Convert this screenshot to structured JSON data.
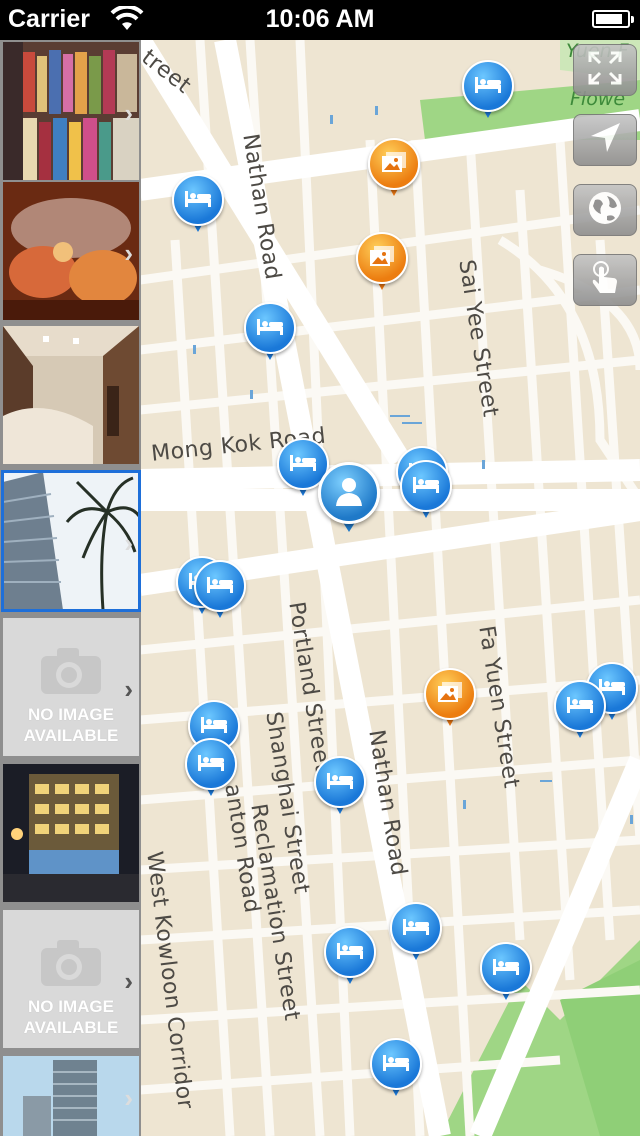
{
  "status_bar": {
    "carrier": "Carrier",
    "time": "10:06 AM",
    "battery_level": 0.8
  },
  "map": {
    "streets": [
      {
        "name": "Nathan Road",
        "id": "nathan-road-north"
      },
      {
        "name": "Sai Yee Street",
        "id": "sai-yee-street"
      },
      {
        "name": "Mong Kok Road",
        "id": "mong-kok-road"
      },
      {
        "name": "Portland Street",
        "id": "portland-street"
      },
      {
        "name": "Fa Yuen Street",
        "id": "fa-yuen-street"
      },
      {
        "name": "Shanghai Street",
        "id": "shanghai-street"
      },
      {
        "name": "Nathan Road",
        "id": "nathan-road-south"
      },
      {
        "name": "Reclamation Street",
        "id": "reclamation-street"
      },
      {
        "name": "West Kowloon Corridor",
        "id": "west-kowloon-corridor"
      },
      {
        "name": "anton Road",
        "id": "canton-road"
      },
      {
        "name": "treet",
        "id": "street-fragment-top"
      },
      {
        "name": "Flowe",
        "id": "flower-park-fragment"
      },
      {
        "name": "Yuen F",
        "id": "yuen-fragment"
      }
    ],
    "controls": [
      {
        "name": "fullscreen",
        "icon": "expand-icon"
      },
      {
        "name": "locate",
        "icon": "location-arrow-icon"
      },
      {
        "name": "map-type",
        "icon": "globe-icon"
      },
      {
        "name": "touch",
        "icon": "hand-pointer-icon"
      }
    ],
    "pins": {
      "hotel_icon": "bed-icon",
      "photo_icon": "photo-icon",
      "user_icon": "user-silhouette-icon",
      "hotel_color": "#1a78d8",
      "photo_color": "#ec7d10"
    }
  },
  "sidebar": {
    "thumbnails": [
      {
        "kind": "photo",
        "scene": "market-stalls"
      },
      {
        "kind": "photo",
        "scene": "aquarium"
      },
      {
        "kind": "photo",
        "scene": "lobby"
      },
      {
        "kind": "photo",
        "scene": "tower-and-palms",
        "selected": true
      },
      {
        "kind": "no-image",
        "text_line1": "NO IMAGE",
        "text_line2": "AVAILABLE"
      },
      {
        "kind": "photo",
        "scene": "night-hotel"
      },
      {
        "kind": "no-image",
        "text_line1": "NO IMAGE",
        "text_line2": "AVAILABLE"
      },
      {
        "kind": "photo",
        "scene": "tower-sky"
      }
    ]
  }
}
